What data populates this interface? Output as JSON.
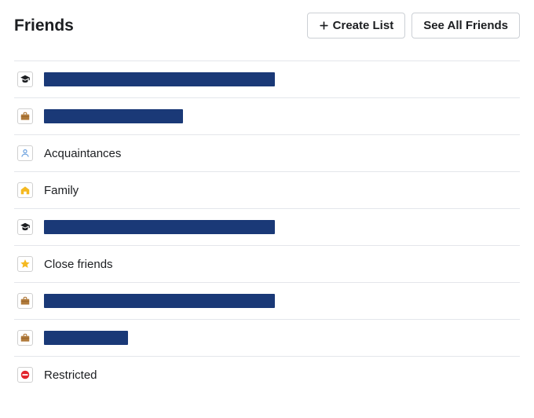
{
  "header": {
    "title": "Friends",
    "create_list_label": "Create List",
    "see_all_label": "See All Friends"
  },
  "colors": {
    "redact_bar": "#1a3977"
  },
  "rows": [
    {
      "icon": "education",
      "redacted": true,
      "redact_width": 294
    },
    {
      "icon": "work",
      "redacted": true,
      "redact_width": 177
    },
    {
      "icon": "person",
      "redacted": false,
      "label": "Acquaintances"
    },
    {
      "icon": "home",
      "redacted": false,
      "label": "Family"
    },
    {
      "icon": "education",
      "redacted": true,
      "redact_width": 294
    },
    {
      "icon": "star",
      "redacted": false,
      "label": "Close friends"
    },
    {
      "icon": "work",
      "redacted": true,
      "redact_width": 294
    },
    {
      "icon": "work",
      "redacted": true,
      "redact_width": 107
    },
    {
      "icon": "restricted",
      "redacted": false,
      "label": "Restricted"
    }
  ]
}
